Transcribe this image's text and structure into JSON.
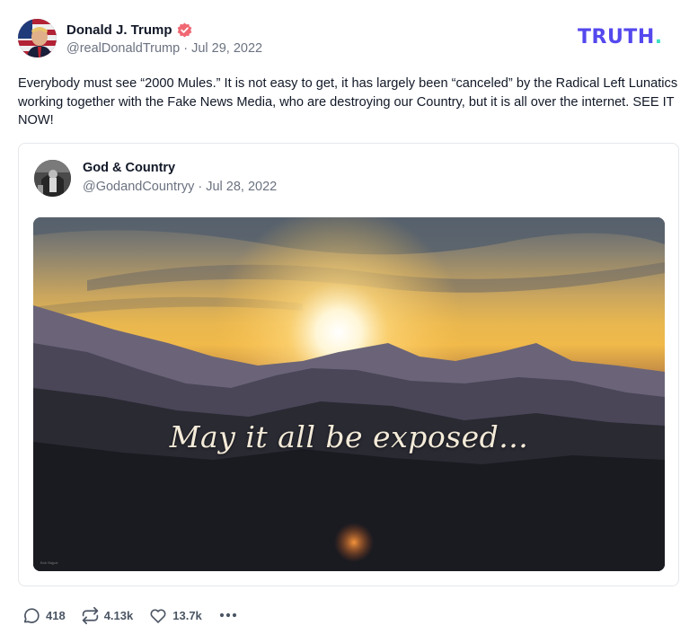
{
  "author": {
    "display_name": "Donald J. Trump",
    "handle": "@realDonaldTrump",
    "date": "Jul 29, 2022",
    "verified_color": "#f06873"
  },
  "brand": {
    "logo_text": "TRUTH",
    "logo_dot": ".",
    "color": "#5448ee",
    "dot_color": "#3fe0c5"
  },
  "post": {
    "text": "Everybody must see “2000 Mules.” It is not easy to get, it has largely been “canceled” by the Radical Left Lunatics working together with the Fake News Media, who are destroying our Country, but it is all over the internet. SEE IT NOW!"
  },
  "quoted": {
    "display_name": "God & Country",
    "handle": "@GodandCountryy",
    "date": "Jul 28, 2022",
    "image_caption": "May it all be exposed...",
    "watermark": "Bob Bajpai"
  },
  "actions": {
    "replies": "418",
    "retruths": "4.13k",
    "likes": "13.7k",
    "icons": [
      "reply-icon",
      "retruth-icon",
      "like-icon",
      "more-icon"
    ]
  }
}
